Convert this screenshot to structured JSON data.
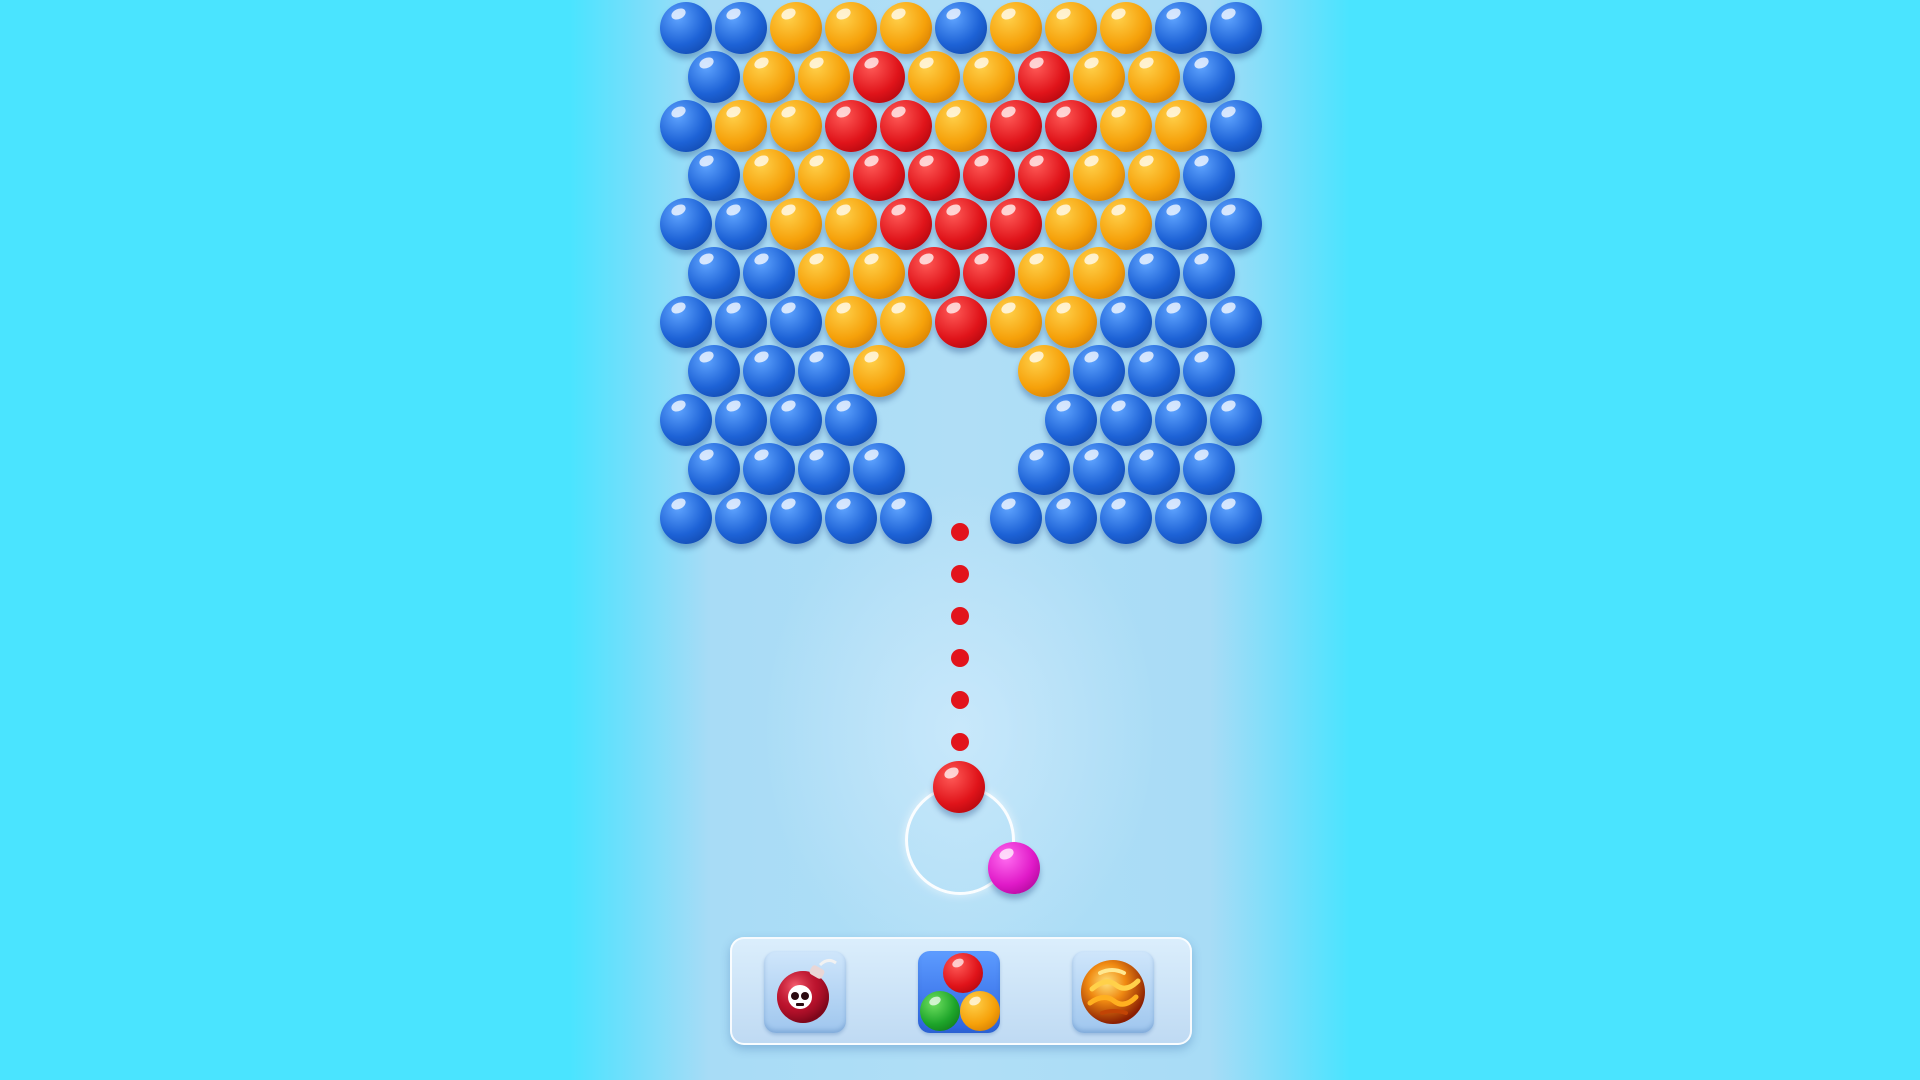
{
  "game": {
    "colors": {
      "background": "#4ae4ff",
      "blue": "#1d62d6",
      "orange": "#f6a10a",
      "red": "#e0141a",
      "magenta": "#e01ac8",
      "green": "#1ea52a"
    },
    "bubble_grid": {
      "rows": [
        [
          "blue",
          "blue",
          "orange",
          "orange",
          "orange",
          "blue",
          "orange",
          "orange",
          "orange",
          "blue",
          "blue"
        ],
        [
          "blue",
          "orange",
          "orange",
          "red",
          "orange",
          "orange",
          "red",
          "orange",
          "orange",
          "blue"
        ],
        [
          "blue",
          "orange",
          "orange",
          "red",
          "red",
          "orange",
          "red",
          "red",
          "orange",
          "orange",
          "blue"
        ],
        [
          "blue",
          "orange",
          "orange",
          "red",
          "red",
          "red",
          "red",
          "orange",
          "orange",
          "blue"
        ],
        [
          "blue",
          "blue",
          "orange",
          "orange",
          "red",
          "red",
          "red",
          "orange",
          "orange",
          "blue",
          "blue"
        ],
        [
          "blue",
          "blue",
          "orange",
          "orange",
          "red",
          "red",
          "orange",
          "orange",
          "blue",
          "blue"
        ],
        [
          "blue",
          "blue",
          "blue",
          "orange",
          "orange",
          "red",
          "orange",
          "orange",
          "blue",
          "blue",
          "blue"
        ],
        [
          "blue",
          "blue",
          "blue",
          "orange",
          null,
          null,
          "orange",
          "blue",
          "blue",
          "blue"
        ],
        [
          "blue",
          "blue",
          "blue",
          "blue",
          null,
          null,
          null,
          "blue",
          "blue",
          "blue",
          "blue"
        ],
        [
          "blue",
          "blue",
          "blue",
          "blue",
          null,
          null,
          "blue",
          "blue",
          "blue",
          "blue"
        ],
        [
          "blue",
          "blue",
          "blue",
          "blue",
          "blue",
          null,
          "blue",
          "blue",
          "blue",
          "blue",
          "blue"
        ]
      ]
    },
    "aim_line": {
      "color": "red",
      "dot_count": 6
    },
    "shooter": {
      "current_bubble": "red",
      "next_bubble": "magenta"
    },
    "boosters": [
      {
        "name": "bomb",
        "icon": "bomb-icon"
      },
      {
        "name": "color-swap",
        "icon": "color-balls-icon"
      },
      {
        "name": "fireball",
        "icon": "fireball-icon"
      }
    ]
  }
}
